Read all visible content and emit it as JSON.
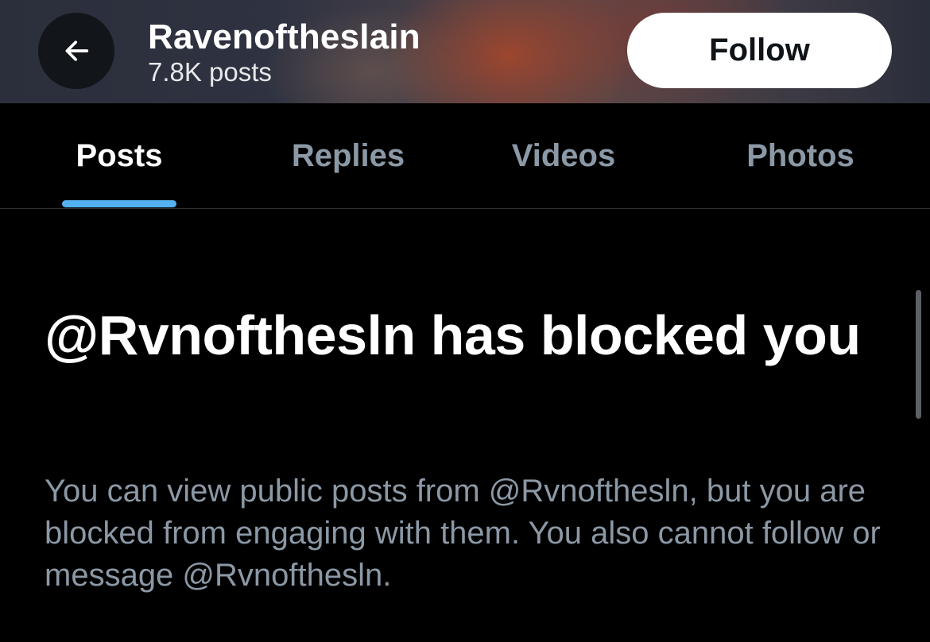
{
  "header": {
    "name": "Ravenoftheslain",
    "post_count": "7.8K posts",
    "follow_label": "Follow",
    "back_icon": "arrow-left-icon"
  },
  "tabs": [
    {
      "label": "Posts",
      "active": true
    },
    {
      "label": "Replies",
      "active": false
    },
    {
      "label": "Videos",
      "active": false
    },
    {
      "label": "Photos",
      "active": false
    }
  ],
  "blocked": {
    "title": "@Rvnofthesln has blocked you",
    "description": "You can view public posts from @Rvnofthesln, but you are blocked from engaging with them. You also cannot follow or message @Rvnofthesln."
  },
  "colors": {
    "background": "#000000",
    "accent": "#1d9bf0",
    "muted_text": "#8b98a5"
  }
}
